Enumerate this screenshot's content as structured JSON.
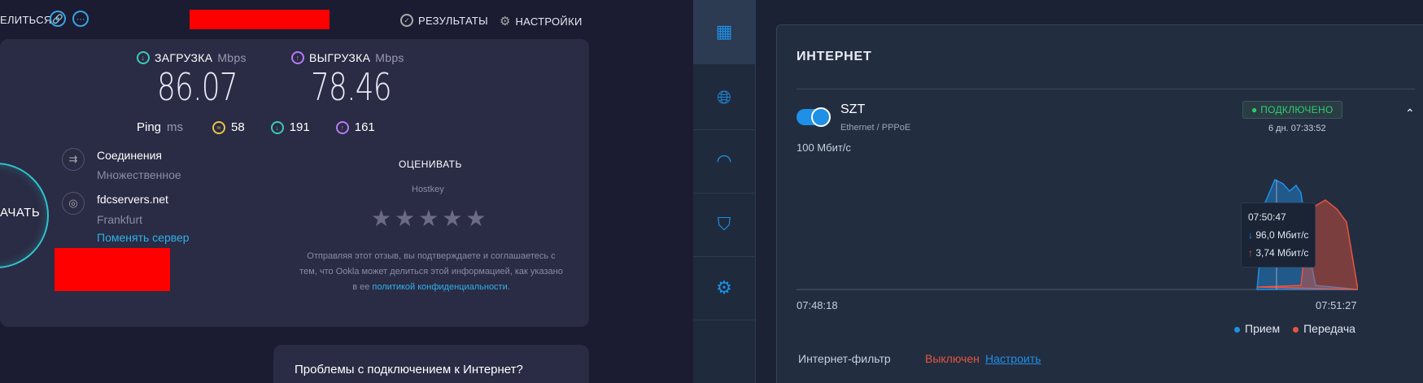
{
  "speedtest": {
    "share_label": "ЕЛИТЬСЯ",
    "results_label": "РЕЗУЛЬТАТЫ",
    "settings_label": "НАСТРОЙКИ",
    "download": {
      "label": "ЗАГРУЗКА",
      "unit": "Mbps",
      "value": "86.07"
    },
    "upload": {
      "label": "ВЫГРУЗКА",
      "unit": "Mbps",
      "value": "78.46"
    },
    "ping": {
      "label": "Ping",
      "unit": "ms",
      "idle": "58",
      "down": "191",
      "up": "161"
    },
    "connections": {
      "title": "Соединения",
      "value": "Множественное"
    },
    "server": {
      "name": "fdcservers.net",
      "city": "Frankfurt",
      "change_link": "Поменять сервер"
    },
    "go_label": "АЧАТЬ",
    "rate": {
      "title": "ОЦЕНИВАТЬ",
      "provider": "Hostkey",
      "stars": "★★★★★",
      "disclaimer_text": "Отправляя этот отзыв, вы подтверждаете и соглашаетесь с тем, что Ookla может делиться этой информацией, как указано в ее ",
      "policy_link": "политикой конфиденциальности",
      "disclaimer_end": "."
    },
    "problem_text": "Проблемы с подключением к Интернет?",
    "colors": {
      "download": "#3ec9b7",
      "upload": "#b67cf2",
      "idle": "#e8c547",
      "accent": "#2fb2e8"
    }
  },
  "router": {
    "panel_title": "ИНТЕРНЕТ",
    "connection": {
      "name": "SZT",
      "type": "Ethernet / PPPoE",
      "status": "ПОДКЛЮЧЕНО",
      "uptime": "6 дн. 07:33:52"
    },
    "chart_data": {
      "type": "area",
      "ylabel": "100 Мбит/с",
      "x_start": "07:48:18",
      "x_end": "07:51:27",
      "series": [
        {
          "name": "Прием",
          "color": "#1e90e6"
        },
        {
          "name": "Передача",
          "color": "#e6553f"
        }
      ],
      "tooltip": {
        "time": "07:50:47",
        "rx": "96,0 Мбит/с",
        "tx": "3,74 Мбит/с"
      }
    },
    "filter": {
      "label": "Интернет-фильтр",
      "status": "Выключен",
      "link": "Настроить"
    }
  }
}
